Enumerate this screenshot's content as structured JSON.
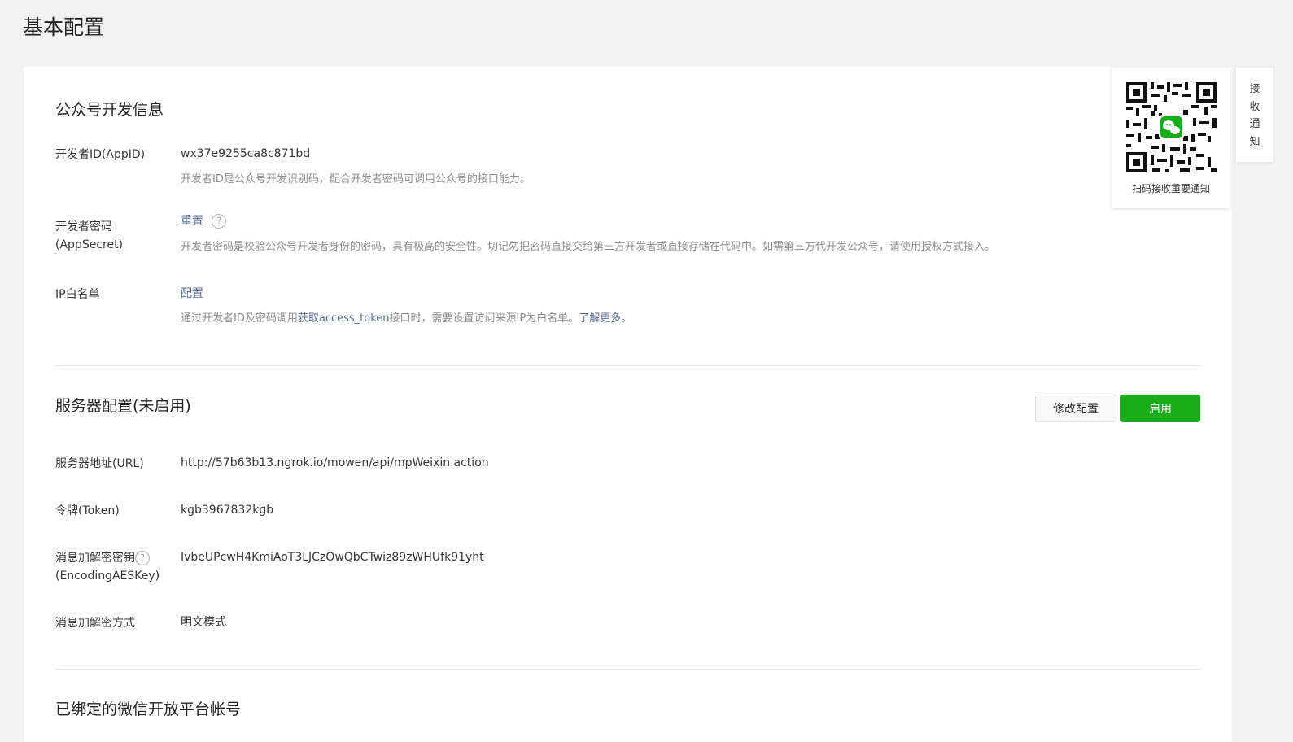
{
  "page_title": "基本配置",
  "dev_info": {
    "title": "公众号开发信息",
    "appid": {
      "label": "开发者ID(AppID)",
      "value": "wx37e9255ca8c871bd",
      "desc": "开发者ID是公众号开发识别码，配合开发者密码可调用公众号的接口能力。"
    },
    "appsecret": {
      "label_line1": "开发者密码",
      "label_line2": "(AppSecret)",
      "action": "重置",
      "help": "?",
      "desc": "开发者密码是校验公众号开发者身份的密码，具有极高的安全性。切记勿把密码直接交给第三方开发者或直接存储在代码中。如需第三方代开发公众号，请使用授权方式接入。"
    },
    "ip_whitelist": {
      "label": "IP白名单",
      "action": "配置",
      "desc_prefix": "通过开发者ID及密码调用",
      "desc_link": "获取access_token",
      "desc_middle": "接口时，需要设置访问来源IP为白名单。",
      "desc_more": "了解更多。"
    }
  },
  "server_config": {
    "title": "服务器配置(未启用)",
    "edit_button": "修改配置",
    "enable_button": "启用",
    "url": {
      "label": "服务器地址(URL)",
      "value": "http://57b63b13.ngrok.io/mowen/api/mpWeixin.action"
    },
    "token": {
      "label": "令牌(Token)",
      "value": "kgb3967832kgb"
    },
    "aeskey": {
      "label_line1": "消息加解密密钥",
      "label_line2": "(EncodingAESKey)",
      "help": "?",
      "value": "IvbeUPcwH4KmiAoT3LJCzOwQbCTwiz89zWHUfk91yht"
    },
    "encrypt_mode": {
      "label": "消息加解密方式",
      "value": "明文模式"
    }
  },
  "bound_platform": {
    "title": "已绑定的微信开放平台帐号"
  },
  "qr_panel": {
    "caption": "扫码接收重要通知",
    "icon": "wechat-qr-icon"
  },
  "side_tab": {
    "label": "接\n收\n通\n知"
  },
  "colors": {
    "primary": "#1aad19",
    "link": "#576b95",
    "muted": "#8d8d8d"
  }
}
